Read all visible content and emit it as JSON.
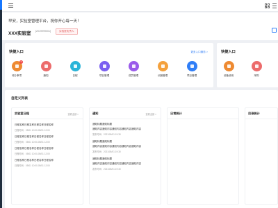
{
  "welcome": {
    "greeting": "早安，实验室管理平台，祝你开心每一天！",
    "lab_name": "XXX实验室",
    "lab_code": "[2019999001]",
    "lab_badge": "实验室负责人"
  },
  "quick_entry": {
    "title": "快捷入口",
    "more": "更多入口服务 >",
    "items": [
      {
        "label": "待办事项",
        "icon": "todo-icon",
        "color": "#ee8a32",
        "badge": "5"
      },
      {
        "label": "通知",
        "icon": "notice-icon",
        "color": "#ec6b6b"
      },
      {
        "label": "日程",
        "icon": "calendar-icon",
        "color": "#2ab4d8"
      },
      {
        "label": "项目管理",
        "icon": "project-icon",
        "color": "#7a5ff0"
      },
      {
        "label": "成员管理",
        "icon": "member-icon",
        "color": "#9a5bea"
      },
      {
        "label": "仪器管理",
        "icon": "instrument-icon",
        "color": "#f4a13c"
      },
      {
        "label": "项目管理",
        "icon": "folder-icon",
        "color": "#2f7ef7"
      }
    ]
  },
  "quick_entry_2": {
    "title": "快捷入口",
    "items": [
      {
        "label": "设备使用",
        "icon": "device-icon",
        "color": "#ee8a32"
      },
      {
        "label": "采购",
        "icon": "purchase-icon",
        "color": "#ec6b6b"
      },
      {
        "label": "",
        "icon": "more-icon",
        "color": "#2ab4d8"
      }
    ]
  },
  "custom_list": {
    "title": "自定义列表",
    "columns": [
      {
        "title": "实验室日程",
        "more": "查看全部 >",
        "items": [
          {
            "title": "日程名称日程名称日程名称日程名称",
            "meta": "日程时间：05/01 10:00-05/01 12:00"
          },
          {
            "title": "日程名称日程名称日程名称日程名称",
            "meta": "日程时间：05/01 10:00-05/01 12:00"
          },
          {
            "title": "日程名称日程名称日程名称日程名称",
            "meta": "日程时间：05/01 10:00-05/01 12:00"
          },
          {
            "title": "日程名称日程名称日程名称日程名称",
            "meta": "日程时间：05/01 10:00-05/01 12:00"
          }
        ]
      },
      {
        "title": "通知",
        "more": "查看全部 >",
        "items": [
          {
            "title": "通知标题通知标题",
            "desc": "通知内容通知内容通知内容通知内容通知内容",
            "meta": "发布时间：2021/05/01 19:30"
          },
          {
            "title": "通知标题通知标题",
            "desc": "通知内容通知内容通知内容通知内容通知内容",
            "meta": "发布时间：2021/05/01 19:30"
          },
          {
            "title": "通知标题通知标题",
            "desc": "通知内容通知内容通知内容通知内容通知内容",
            "meta": "发布时间：2021/05/01 19:30"
          }
        ]
      },
      {
        "title": "日常统计"
      },
      {
        "title": "目录统计"
      }
    ]
  }
}
